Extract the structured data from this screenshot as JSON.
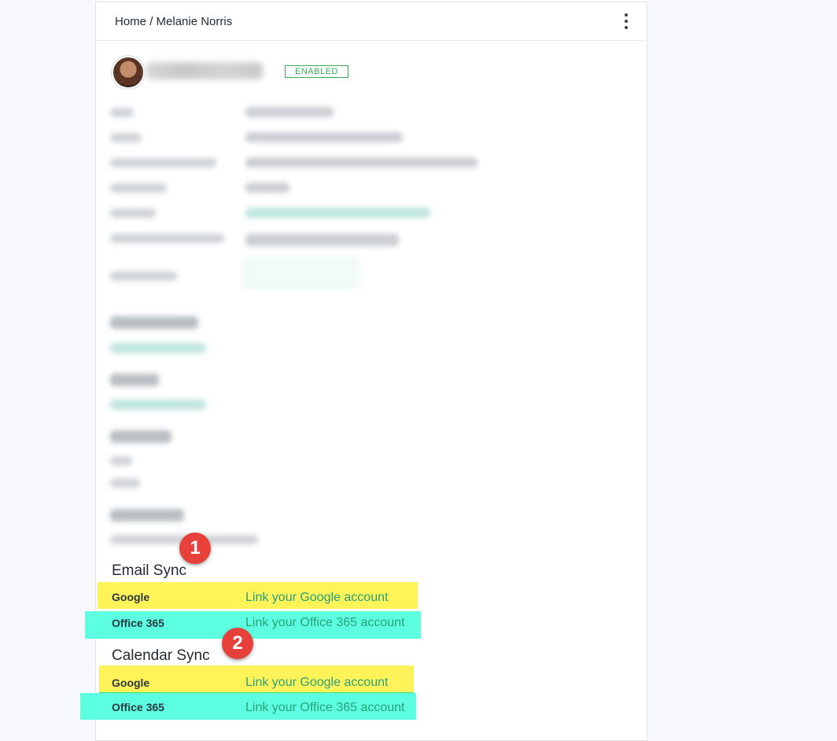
{
  "breadcrumb": {
    "home": "Home",
    "separator": "/",
    "current": "Melanie Norris"
  },
  "header": {
    "menu_icon": "kebab-menu-icon"
  },
  "profile": {
    "status": "ENABLED",
    "status_color": "#3aa857"
  },
  "email_sync": {
    "title": "Email Sync",
    "rows": [
      {
        "provider": "Google",
        "link": "Link your Google account"
      },
      {
        "provider": "Office 365",
        "link": "Link your Office 365 account"
      }
    ]
  },
  "calendar_sync": {
    "title": "Calendar Sync",
    "rows": [
      {
        "provider": "Google",
        "link": "Link your Google account"
      },
      {
        "provider": "Office 365",
        "link": "Link your Office 365 account"
      }
    ]
  },
  "annotations": {
    "marker_1": "1",
    "marker_2": "2"
  },
  "colors": {
    "highlight_yellow": "#fff35a",
    "highlight_cyan": "#5cffe0",
    "link": "#2aa07a",
    "marker": "#e8403b"
  }
}
